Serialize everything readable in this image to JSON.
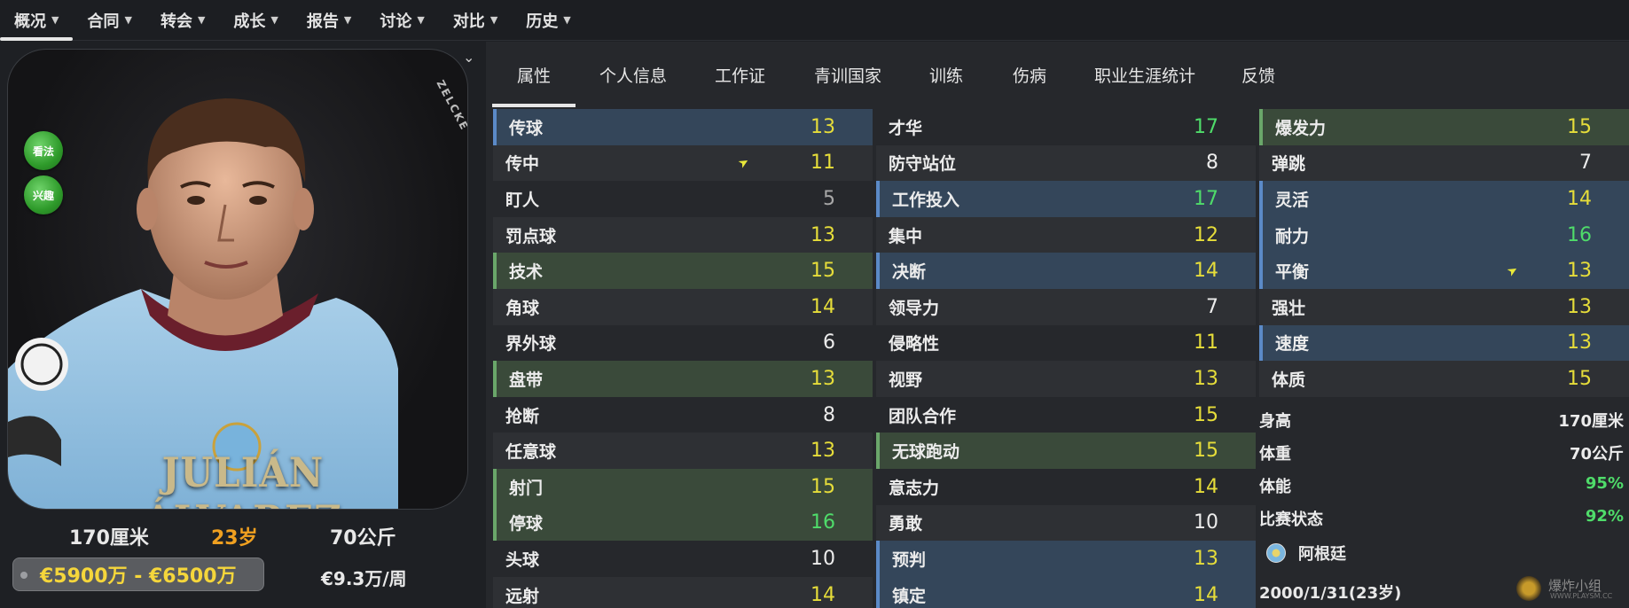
{
  "nav": {
    "items": [
      {
        "label": "概况",
        "active": true
      },
      {
        "label": "合同"
      },
      {
        "label": "转会"
      },
      {
        "label": "成长"
      },
      {
        "label": "报告"
      },
      {
        "label": "讨论"
      },
      {
        "label": "对比"
      },
      {
        "label": "历史"
      }
    ]
  },
  "profile": {
    "name_art": "JULIÁN ÁLVAREZ",
    "brand_art": "ZELCKE",
    "btn_view": "看法",
    "btn_interest": "兴趣",
    "height": "170厘米",
    "age": "23岁",
    "weight": "70公斤",
    "value": "€5900万 - €6500万",
    "wage": "€9.3万/周"
  },
  "subtabs": [
    "属性",
    "个人信息",
    "工作证",
    "青训国家",
    "训练",
    "伤病",
    "职业生涯统计",
    "反馈"
  ],
  "attributes": {
    "technical": [
      {
        "label": "传球",
        "value": "13",
        "hl": "blue"
      },
      {
        "label": "传中",
        "value": "11",
        "arrow": true
      },
      {
        "label": "盯人",
        "value": "5"
      },
      {
        "label": "罚点球",
        "value": "13"
      },
      {
        "label": "技术",
        "value": "15",
        "hl": "green"
      },
      {
        "label": "角球",
        "value": "14"
      },
      {
        "label": "界外球",
        "value": "6"
      },
      {
        "label": "盘带",
        "value": "13",
        "hl": "green"
      },
      {
        "label": "抢断",
        "value": "8"
      },
      {
        "label": "任意球",
        "value": "13"
      },
      {
        "label": "射门",
        "value": "15",
        "hl": "green"
      },
      {
        "label": "停球",
        "value": "16",
        "hl": "green"
      },
      {
        "label": "头球",
        "value": "10"
      },
      {
        "label": "远射",
        "value": "14"
      }
    ],
    "mental": [
      {
        "label": "才华",
        "value": "17"
      },
      {
        "label": "防守站位",
        "value": "8"
      },
      {
        "label": "工作投入",
        "value": "17",
        "hl": "blue"
      },
      {
        "label": "集中",
        "value": "12"
      },
      {
        "label": "决断",
        "value": "14",
        "hl": "blue"
      },
      {
        "label": "领导力",
        "value": "7"
      },
      {
        "label": "侵略性",
        "value": "11"
      },
      {
        "label": "视野",
        "value": "13"
      },
      {
        "label": "团队合作",
        "value": "15"
      },
      {
        "label": "无球跑动",
        "value": "15",
        "hl": "green"
      },
      {
        "label": "意志力",
        "value": "14"
      },
      {
        "label": "勇敢",
        "value": "10"
      },
      {
        "label": "预判",
        "value": "13",
        "hl": "blue"
      },
      {
        "label": "镇定",
        "value": "14",
        "hl": "blue"
      }
    ],
    "physical": [
      {
        "label": "爆发力",
        "value": "15",
        "hl": "green"
      },
      {
        "label": "弹跳",
        "value": "7"
      },
      {
        "label": "灵活",
        "value": "14",
        "hl": "blue"
      },
      {
        "label": "耐力",
        "value": "16",
        "hl": "blue"
      },
      {
        "label": "平衡",
        "value": "13",
        "hl": "blue",
        "arrow": true
      },
      {
        "label": "强壮",
        "value": "13"
      },
      {
        "label": "速度",
        "value": "13",
        "hl": "blue"
      },
      {
        "label": "体质",
        "value": "15"
      }
    ]
  },
  "info": {
    "height_label": "身高",
    "height": "170厘米",
    "weight_label": "体重",
    "weight": "70公斤",
    "fitness_label": "体能",
    "fitness": "95%",
    "form_label": "比赛状态",
    "form": "92%",
    "nation": "阿根廷",
    "dob": "2000/1/31(23岁)"
  },
  "watermark": {
    "text": "爆炸小组",
    "sub": "WWW.PLAYSM.CC"
  },
  "colors": {
    "val_low": "#a8a8a8",
    "val_white": "#ececec",
    "val_yellow": "#e6dd3a",
    "val_green": "#4fdc6a",
    "highlight_blue": "#34465a",
    "highlight_green": "#3a4a3a"
  }
}
